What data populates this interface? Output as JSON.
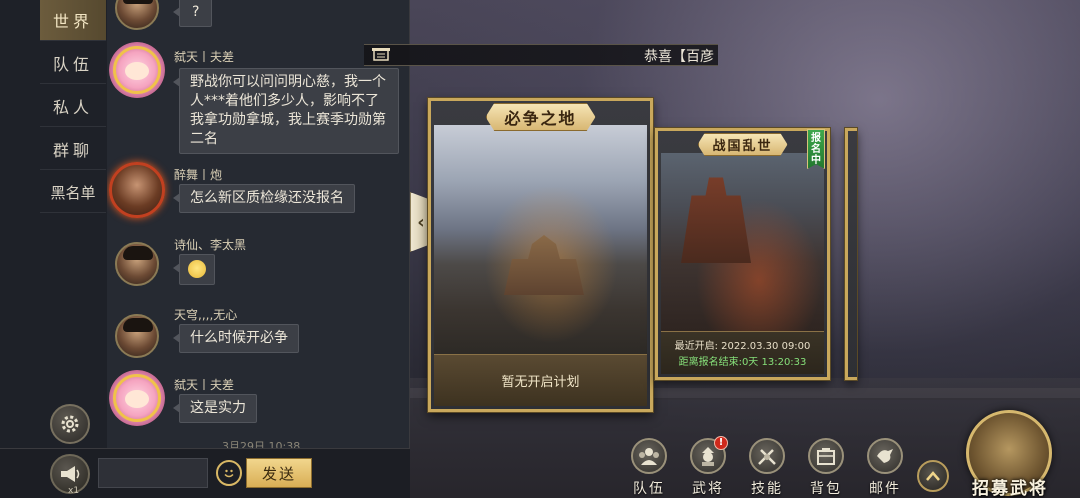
{
  "tabs": [
    {
      "label": "世界",
      "active": true
    },
    {
      "label": "队伍",
      "active": false
    },
    {
      "label": "私人",
      "active": false
    },
    {
      "label": "群聊",
      "active": false
    },
    {
      "label": "黑名单",
      "active": false
    }
  ],
  "messages": [
    {
      "sender": "",
      "text": "?",
      "avatar": "warrior"
    },
    {
      "sender": "弑天丨夫差",
      "text": "野战你可以问问明心慈，我一个人***着他们多少人，影响不了我拿功勋拿城，我上赛季功勋第二名",
      "avatar": "pink-crown"
    },
    {
      "sender": "醉舞丨炮",
      "text": "怎么新区质检缘还没报名",
      "avatar": "fire-frame"
    },
    {
      "sender": "诗仙、李太黑",
      "text": "",
      "emoji": "smile-emoji",
      "avatar": "warrior"
    },
    {
      "sender": "天穹,,,,无心",
      "text": "什么时候开必争",
      "avatar": "warrior"
    },
    {
      "sender": "弑天丨夫差",
      "text": "这是实力",
      "avatar": "pink-crown"
    }
  ],
  "timestamp": "3月29日 10:38",
  "input": {
    "value": "",
    "placeholder": ""
  },
  "horn_count": "x1",
  "send_label": "发送",
  "announcement": "恭喜【百彦",
  "cards": [
    {
      "title": "必争之地",
      "footer": "暂无开启计划"
    },
    {
      "title": "战国乱世",
      "badge": "报名中",
      "recent_open": "最近开启: 2022.03.30 09:00",
      "deadline": "距离报名结束:0天 13:20:33"
    }
  ],
  "nav": [
    {
      "label": "队伍",
      "icon": "team-icon"
    },
    {
      "label": "武将",
      "icon": "general-icon",
      "badge": "!"
    },
    {
      "label": "技能",
      "icon": "skill-icon"
    },
    {
      "label": "背包",
      "icon": "bag-icon"
    },
    {
      "label": "邮件",
      "icon": "mail-icon"
    }
  ],
  "recruit_label": "招募武将",
  "colors": {
    "accent_gold": "#d9ae55",
    "deadline_green": "#86e07a",
    "badge_green": "#3ea84c",
    "alert_red": "#d0291c"
  }
}
